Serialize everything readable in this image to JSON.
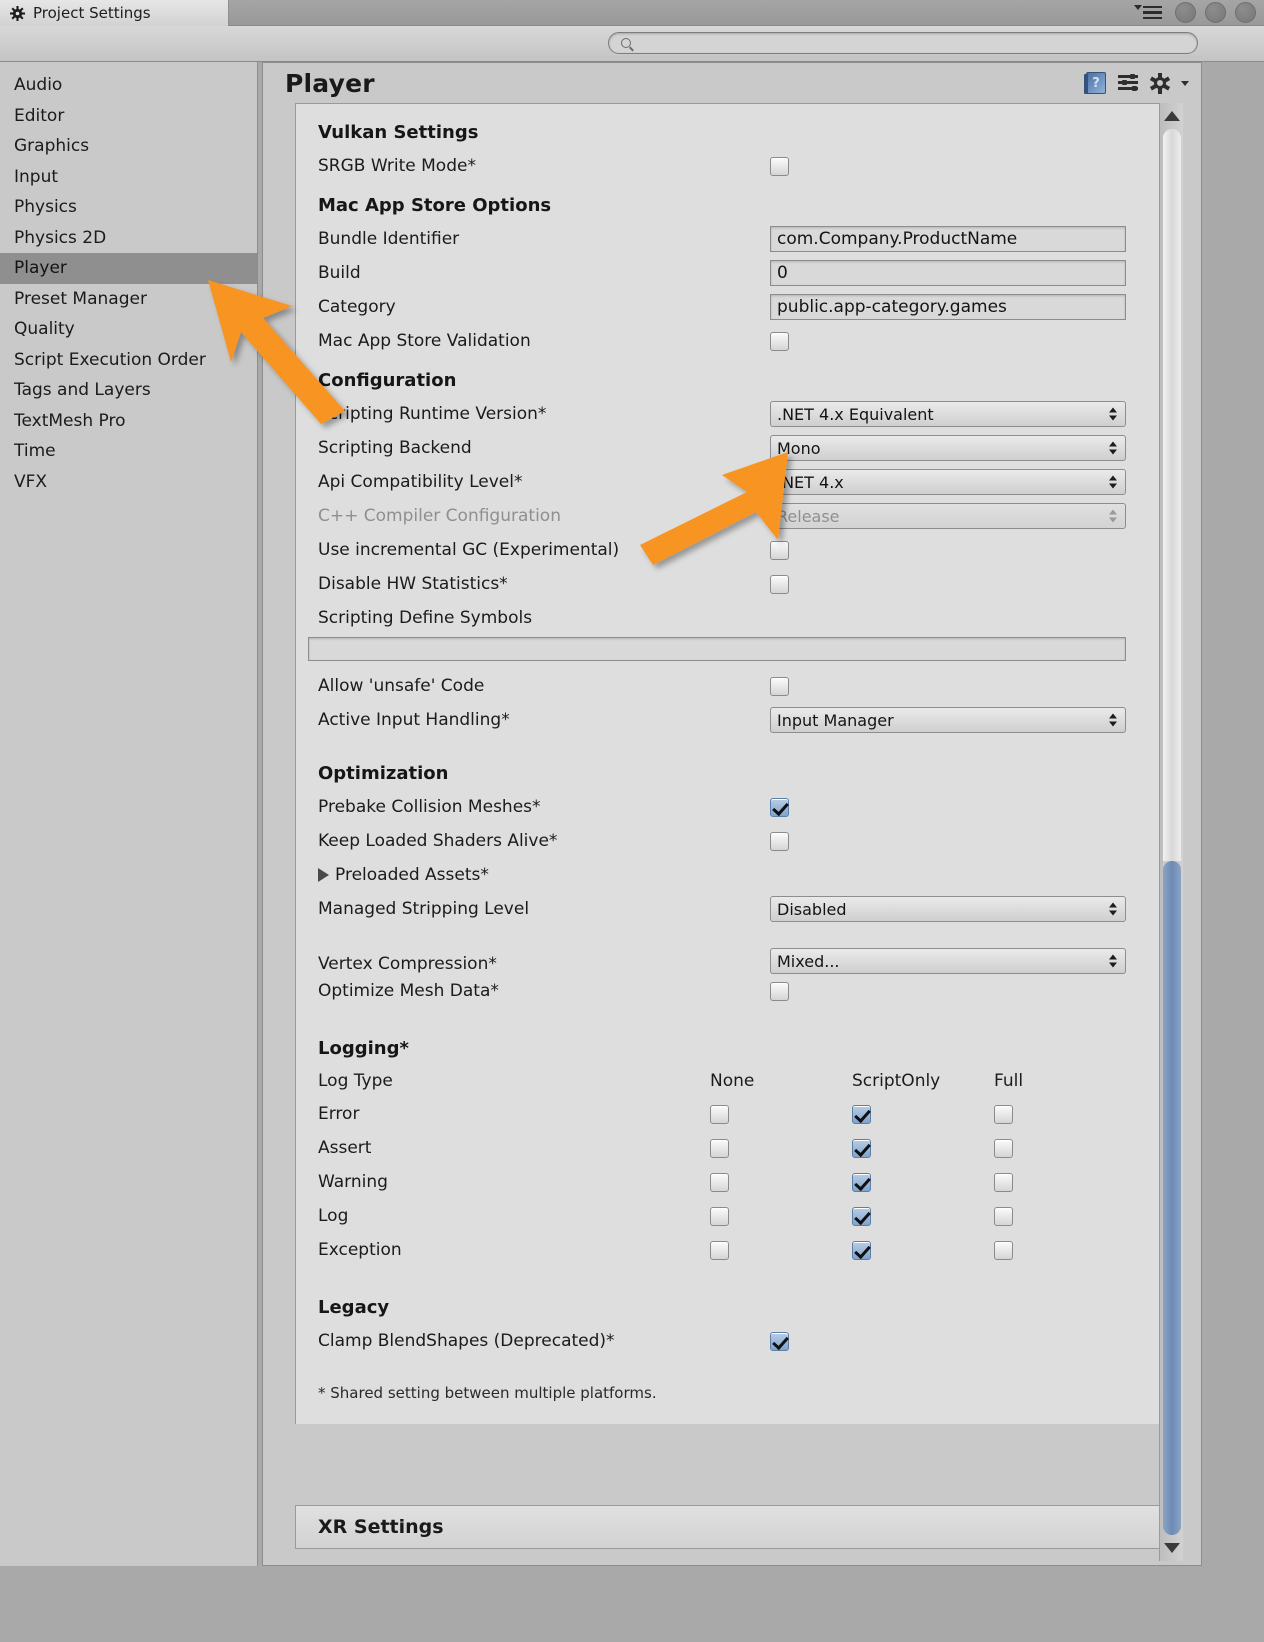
{
  "window": {
    "tab_title": "Project Settings",
    "tab_icon": "gear-icon",
    "menu_icon": "hamburger-menu-icon",
    "window_buttons": [
      "window-button-1",
      "window-button-2",
      "window-button-3"
    ]
  },
  "search": {
    "icon": "search-icon",
    "value": "",
    "placeholder": ""
  },
  "sidebar": {
    "items": [
      {
        "label": "Audio",
        "selected": false
      },
      {
        "label": "Editor",
        "selected": false
      },
      {
        "label": "Graphics",
        "selected": false
      },
      {
        "label": "Input",
        "selected": false
      },
      {
        "label": "Physics",
        "selected": false
      },
      {
        "label": "Physics 2D",
        "selected": false
      },
      {
        "label": "Player",
        "selected": true
      },
      {
        "label": "Preset Manager",
        "selected": false
      },
      {
        "label": "Quality",
        "selected": false
      },
      {
        "label": "Script Execution Order",
        "selected": false
      },
      {
        "label": "Tags and Layers",
        "selected": false
      },
      {
        "label": "TextMesh Pro",
        "selected": false
      },
      {
        "label": "Time",
        "selected": false
      },
      {
        "label": "VFX",
        "selected": false
      }
    ]
  },
  "panel": {
    "title": "Player",
    "icons": [
      "help-book-icon",
      "preset-sliders-icon",
      "gear-icon"
    ]
  },
  "sections": {
    "vulkan": {
      "title": "Vulkan Settings",
      "rows": [
        {
          "label": "SRGB Write Mode*",
          "type": "checkbox",
          "checked": false
        }
      ]
    },
    "macstore": {
      "title": "Mac App Store Options",
      "rows": [
        {
          "label": "Bundle Identifier",
          "type": "text",
          "value": "com.Company.ProductName"
        },
        {
          "label": "Build",
          "type": "text",
          "value": "0"
        },
        {
          "label": "Category",
          "type": "text",
          "value": "public.app-category.games"
        },
        {
          "label": "Mac App Store Validation",
          "type": "checkbox",
          "checked": false
        }
      ]
    },
    "configuration": {
      "title": "Configuration",
      "rows": [
        {
          "label": "Scripting Runtime Version*",
          "type": "dropdown",
          "value": ".NET 4.x Equivalent",
          "disabled": false
        },
        {
          "label": "Scripting Backend",
          "type": "dropdown",
          "value": "Mono",
          "disabled": false
        },
        {
          "label": "Api Compatibility Level*",
          "type": "dropdown",
          "value": ".NET 4.x",
          "disabled": false
        },
        {
          "label": "C++ Compiler Configuration",
          "type": "dropdown",
          "value": "Release",
          "disabled": true
        },
        {
          "label": "Use incremental GC (Experimental)",
          "type": "checkbox",
          "checked": false
        },
        {
          "label": "Disable HW Statistics*",
          "type": "checkbox",
          "checked": false
        }
      ],
      "define_symbols_label": "Scripting Define Symbols",
      "define_symbols_value": "",
      "rows2": [
        {
          "label": "Allow 'unsafe' Code",
          "type": "checkbox",
          "checked": false
        },
        {
          "label": "Active Input Handling*",
          "type": "dropdown",
          "value": "Input Manager",
          "disabled": false
        }
      ]
    },
    "optimization": {
      "title": "Optimization",
      "rows": [
        {
          "label": "Prebake Collision Meshes*",
          "type": "checkbox",
          "checked": true
        },
        {
          "label": "Keep Loaded Shaders Alive*",
          "type": "checkbox",
          "checked": false
        },
        {
          "label": "Preloaded Assets*",
          "type": "foldout",
          "expanded": false
        },
        {
          "label": "Managed Stripping Level",
          "type": "dropdown",
          "value": "Disabled",
          "disabled": false
        },
        {
          "label": "Vertex Compression*",
          "type": "dropdown",
          "value": "Mixed...",
          "disabled": false
        },
        {
          "label": "Optimize Mesh Data*",
          "type": "checkbox",
          "checked": false
        }
      ]
    },
    "logging": {
      "title": "Logging*",
      "header": {
        "row_label": "Log Type",
        "columns": [
          "None",
          "ScriptOnly",
          "Full"
        ]
      },
      "rows": [
        {
          "label": "Error",
          "none": false,
          "scriptonly": true,
          "full": false
        },
        {
          "label": "Assert",
          "none": false,
          "scriptonly": true,
          "full": false
        },
        {
          "label": "Warning",
          "none": false,
          "scriptonly": true,
          "full": false
        },
        {
          "label": "Log",
          "none": false,
          "scriptonly": true,
          "full": false
        },
        {
          "label": "Exception",
          "none": false,
          "scriptonly": true,
          "full": false
        }
      ]
    },
    "legacy": {
      "title": "Legacy",
      "rows": [
        {
          "label": "Clamp BlendShapes (Deprecated)*",
          "type": "checkbox",
          "checked": true
        }
      ]
    },
    "footnote": "* Shared setting between multiple platforms.",
    "xr": {
      "label": "XR Settings"
    }
  },
  "annotations": {
    "color": "#F79420",
    "arrows": [
      {
        "name": "arrow-to-player-sidebar-item"
      },
      {
        "name": "arrow-to-scripting-runtime-version-dropdown"
      }
    ]
  },
  "scrollbar": {
    "up_icon": "scroll-up-arrow-icon",
    "down_icon": "scroll-down-arrow-icon"
  }
}
